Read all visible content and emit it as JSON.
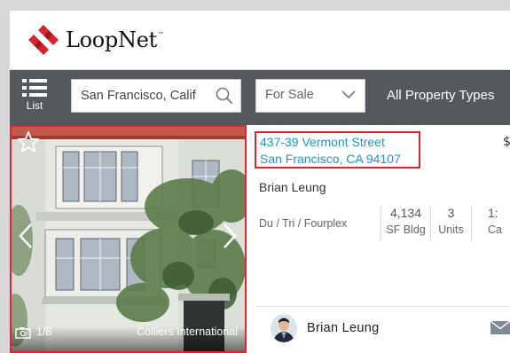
{
  "brand": {
    "name": "LoopNet",
    "tm": "™"
  },
  "searchbar": {
    "list_label": "List",
    "search_value": "San Francisco, Calif",
    "sale_value": "For Sale",
    "property_types": "All Property Types"
  },
  "listing": {
    "address_line1": "437-39 Vermont Street",
    "address_line2": "San Francisco, CA 94107",
    "price_fragment": "$",
    "broker_name": "Brian Leung",
    "property_type": "Du / Tri / Fourplex",
    "stats": [
      {
        "value": "4,134",
        "label": "SF Bldg"
      },
      {
        "value": "3",
        "label": "Units"
      },
      {
        "value": "1:",
        "label": "Ca"
      }
    ],
    "photo_count": "1/8",
    "photo_credit": "Colliers International",
    "contact_name": "Brian Leung"
  },
  "colors": {
    "accent_red": "#e0232f",
    "link_blue": "#1f96c6",
    "bar_gray": "#54595e"
  }
}
